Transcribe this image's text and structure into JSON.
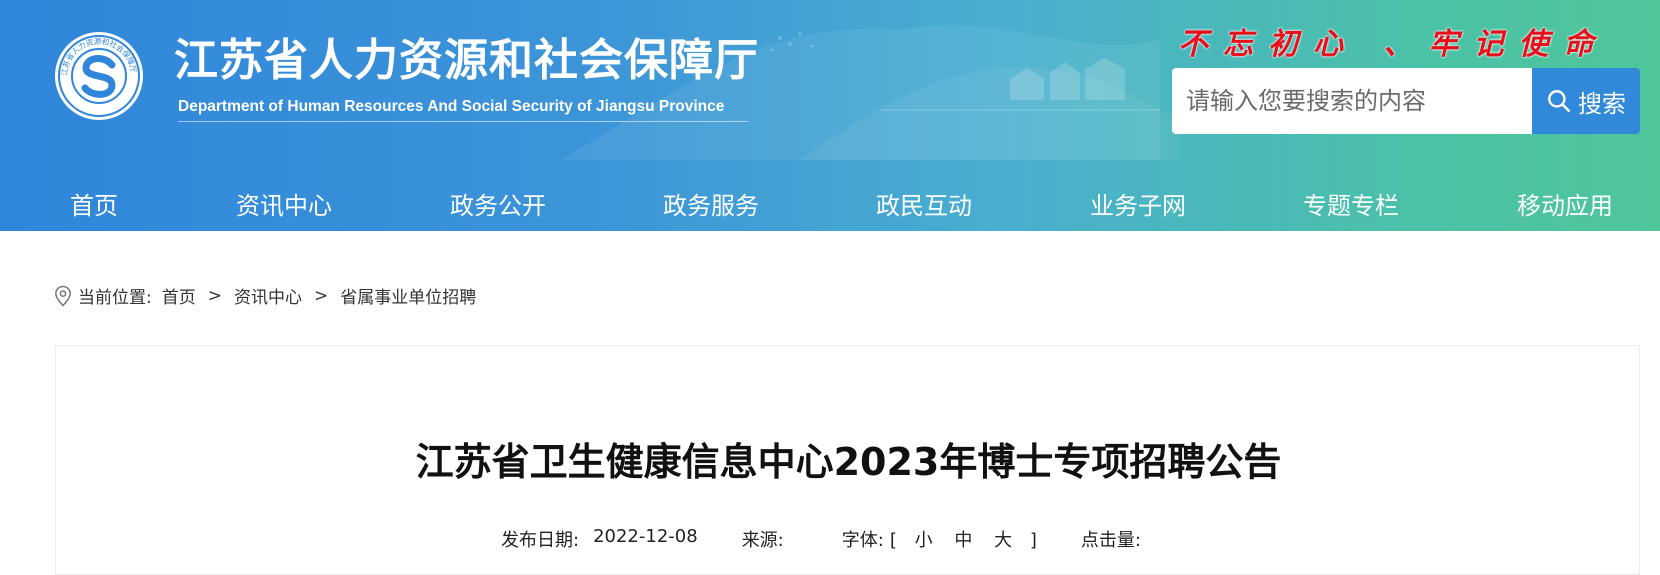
{
  "header": {
    "title": "江苏省人力资源和社会保障厅",
    "subtitle": "Department of Human Resources And Social Security of Jiangsu Province",
    "slogan": "不忘初心 、牢记使命",
    "logo_ring_text": "江苏省人力资源和社会保障厅",
    "search": {
      "placeholder": "请输入您要搜索的内容",
      "button_label": "搜索"
    }
  },
  "nav": {
    "items": [
      "首页",
      "资讯中心",
      "政务公开",
      "政务服务",
      "政民互动",
      "业务子网",
      "专题专栏",
      "移动应用"
    ]
  },
  "breadcrumb": {
    "prefix": "当前位置:",
    "items": [
      "首页",
      "资讯中心",
      "省属事业单位招聘"
    ],
    "separator": ">"
  },
  "article": {
    "title": "江苏省卫生健康信息中心2023年博士专项招聘公告",
    "publish_label": "发布日期:",
    "publish_date": "2022-12-08",
    "source_label": "来源:",
    "source_value": "",
    "font_label": "字体:",
    "font_open": "[",
    "font_small": "小",
    "font_medium": "中",
    "font_large": "大",
    "font_close": "]",
    "clicks_label": "点击量:"
  },
  "colors": {
    "header_gradient_start": "#2f86db",
    "header_gradient_end": "#4fc69a",
    "slogan": "#e8101b",
    "search_button": "#3189d9"
  },
  "icons": [
    "search-icon",
    "location-pin-icon",
    "logo-emblem"
  ]
}
